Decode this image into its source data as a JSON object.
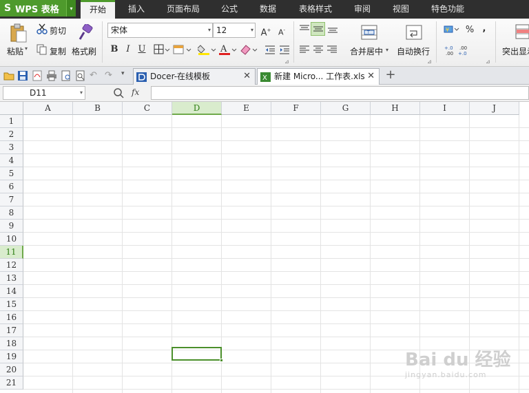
{
  "app": {
    "logo": "S",
    "name": "WPS 表格",
    "menu_arrow": "▾"
  },
  "menu": {
    "items": [
      "开始",
      "插入",
      "页面布局",
      "公式",
      "数据",
      "表格样式",
      "审阅",
      "视图",
      "特色功能"
    ],
    "active_index": 0
  },
  "ribbon": {
    "paste_label": "粘贴",
    "cut_label": "剪切",
    "copy_label": "复制",
    "format_painter_label": "格式刷",
    "font_name": "宋体",
    "font_size": "12",
    "bold": "B",
    "italic": "I",
    "underline": "U",
    "merge_center_label": "合并居中",
    "wrap_text_label": "自动换行",
    "highlight_label": "突出显示",
    "percent": "%",
    "comma": ",",
    "inc_decimal": "+.0\n.00",
    "dec_decimal": ".00\n+.0"
  },
  "doc_tabs": [
    {
      "label": "Docer-在线模板",
      "icon": "docer-icon",
      "close": "✕",
      "active": false
    },
    {
      "label": "新建 Micro... 工作表.xls",
      "icon": "excel-file-icon",
      "close": "✕",
      "active": true
    }
  ],
  "new_tab": "+",
  "formula_bar": {
    "name_box": "D11",
    "fx": "fx",
    "value": ""
  },
  "columns": [
    "A",
    "B",
    "C",
    "D",
    "E",
    "F",
    "G",
    "H",
    "I",
    "J"
  ],
  "rows": [
    "1",
    "2",
    "3",
    "4",
    "5",
    "6",
    "7",
    "8",
    "9",
    "10",
    "11",
    "12",
    "13",
    "14",
    "15",
    "16",
    "17",
    "18",
    "19",
    "20",
    "21"
  ],
  "selection": {
    "column": "D",
    "row": "11"
  },
  "colors": {
    "accent": "#4e9a2c",
    "menubar": "#2f2f2f",
    "selected_header": "#d9eccd"
  },
  "watermark": {
    "main": "Bai du 经验",
    "sub": "jingyan.baidu.com"
  }
}
